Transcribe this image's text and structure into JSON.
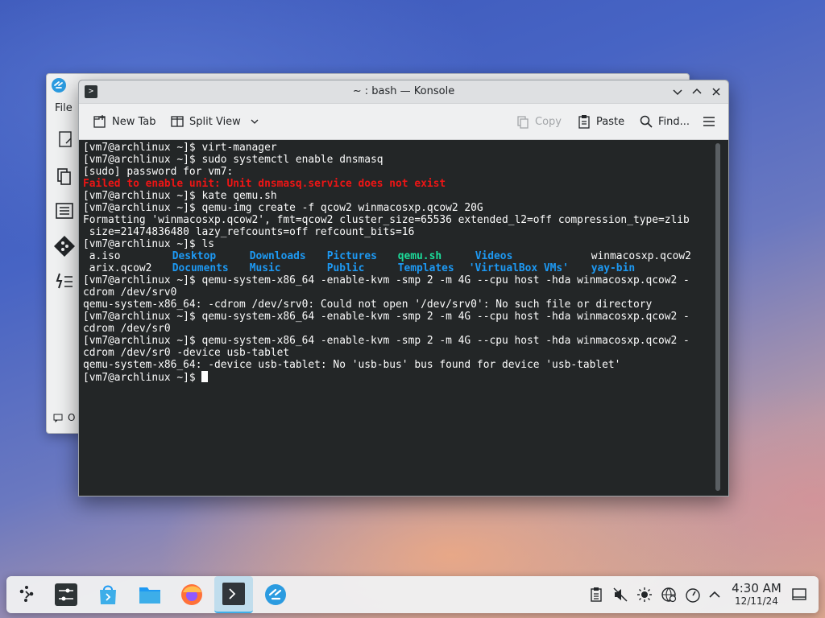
{
  "background_window": {
    "menu_label": "File",
    "status_text": "O"
  },
  "konsole": {
    "title": "~ : bash — Konsole",
    "toolbar": {
      "new_tab": "New Tab",
      "split_view": "Split View",
      "copy": "Copy",
      "paste": "Paste",
      "find": "Find..."
    }
  },
  "terminal": {
    "lines": [
      "[vm7@archlinux ~]$ virt-manager",
      "[vm7@archlinux ~]$ sudo systemctl enable dnsmasq",
      "[sudo] password for vm7:",
      "Failed to enable unit: Unit dnsmasq.service does not exist",
      "[vm7@archlinux ~]$ kate qemu.sh",
      "[vm7@archlinux ~]$ qemu-img create -f qcow2 winmacosxp.qcow2 20G",
      "Formatting 'winmacosxp.qcow2', fmt=qcow2 cluster_size=65536 extended_l2=off compression_type=zlib",
      " size=21474836480 lazy_refcounts=off refcount_bits=16",
      "[vm7@archlinux ~]$ ls",
      "[vm7@archlinux ~]$ qemu-system-x86_64 -enable-kvm -smp 2 -m 4G --cpu host -hda winmacosxp.qcow2 -",
      "cdrom /dev/srv0",
      "qemu-system-x86_64: -cdrom /dev/srv0: Could not open '/dev/srv0': No such file or directory",
      "[vm7@archlinux ~]$ qemu-system-x86_64 -enable-kvm -smp 2 -m 4G --cpu host -hda winmacosxp.qcow2 -",
      "cdrom /dev/sr0",
      "[vm7@archlinux ~]$ qemu-system-x86_64 -enable-kvm -smp 2 -m 4G --cpu host -hda winmacosxp.qcow2 -",
      "cdrom /dev/sr0 -device usb-tablet",
      "qemu-system-x86_64: -device usb-tablet: No 'usb-bus' bus found for device 'usb-tablet'",
      "[vm7@archlinux ~]$ "
    ],
    "ls_row1": [
      "a.iso",
      "Desktop",
      "Downloads",
      "Pictures",
      "qemu.sh",
      "Videos",
      "winmacosxp.qcow2"
    ],
    "ls_row2": [
      "arix.qcow2",
      "Documents",
      "Music",
      "Public",
      "Templates",
      "'VirtualBox VMs'",
      "yay-bin"
    ]
  },
  "taskbar": {
    "time": "4:30 AM",
    "date": "12/11/24"
  },
  "colors": {
    "terminal_bg": "#232627",
    "error_red": "#ed1515",
    "dir_blue": "#1d99f3",
    "exec_green": "#1cdc9a",
    "accent": "#3daee9"
  }
}
